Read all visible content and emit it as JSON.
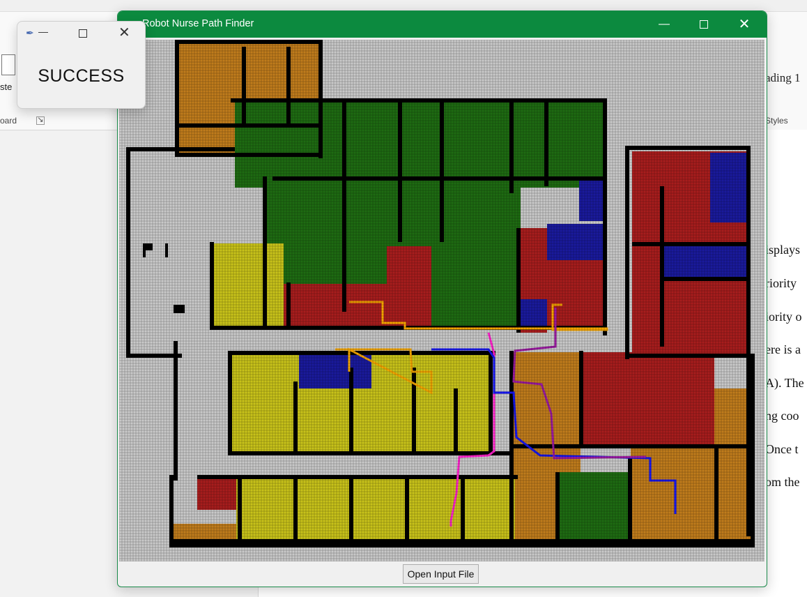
{
  "background_app": {
    "paste_label": "ste",
    "clipboard_label": "oard",
    "heading_style": "ading 1",
    "styles_label": "Styles",
    "doc_lines": [
      "isplays",
      "riority",
      "iority o",
      "ere is a",
      "A). The",
      "ng coo",
      " Once t",
      "om the"
    ]
  },
  "popup": {
    "message": "SUCCESS",
    "feather_icon": "feather-icon",
    "minimize_glyph": "—",
    "close_glyph": "✕"
  },
  "window": {
    "title": "Robot Nurse Path Finder",
    "titlebar_color": "#0c8a3f",
    "minimize_glyph": "—",
    "close_glyph": "✕"
  },
  "map": {
    "legend_colors": {
      "background": "#c9c9c9",
      "wall": "#000000",
      "orange_zone": "#c07c1c",
      "green_zone": "#1e6b12",
      "blue_zone": "#1a1a9c",
      "red_zone": "#a81d1d",
      "yellow_zone": "#c8c21a"
    },
    "paths": [
      {
        "color": "#f5a500"
      },
      {
        "color": "#ff22cc"
      },
      {
        "color": "#1515f0"
      },
      {
        "color": "#9a1aa0"
      }
    ]
  },
  "open_button": {
    "label": "Open Input File"
  }
}
